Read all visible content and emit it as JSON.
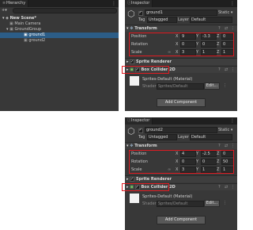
{
  "hierarchy": {
    "tab": "Hierarchy",
    "add_label": "+▾",
    "scene": "New Scene*",
    "items": [
      "Main Camera",
      "GroundGroup",
      "ground1",
      "ground2"
    ]
  },
  "inspector1": {
    "tab": "Inspector",
    "name": "ground1",
    "static_label": "Static ▾",
    "tag_label": "Tag",
    "tag_value": "Untagged",
    "layer_label": "Layer",
    "layer_value": "Default",
    "transform": {
      "title": "Transform",
      "position": {
        "label": "Position",
        "x": "9",
        "y": "-3.3",
        "z": "0"
      },
      "rotation": {
        "label": "Rotation",
        "x": "0",
        "y": "0",
        "z": "0"
      },
      "scale": {
        "label": "Scale",
        "x": "3",
        "y": "1",
        "z": "1"
      }
    },
    "sprite_renderer": "Sprite Renderer",
    "box_collider": "Box Collider 2D",
    "material": "Sprites-Default (Material)",
    "shader_label": "Shader",
    "shader_value": "Sprites/Default",
    "edit_label": "Edit...",
    "add_component": "Add Component"
  },
  "inspector2": {
    "tab": "Inspector",
    "name": "ground2",
    "static_label": "Static ▾",
    "tag_label": "Tag",
    "tag_value": "Untagged",
    "layer_label": "Layer",
    "layer_value": "Default",
    "transform": {
      "title": "Transform",
      "position": {
        "label": "Position",
        "x": "4",
        "y": "-2.5",
        "z": "0"
      },
      "rotation": {
        "label": "Rotation",
        "x": "0",
        "y": "0",
        "z": "50"
      },
      "scale": {
        "label": "Scale",
        "x": "3",
        "y": "1",
        "z": "1"
      }
    },
    "sprite_renderer": "Sprite Renderer",
    "box_collider": "Box Collider 2D",
    "material": "Sprites-Default (Material)",
    "shader_label": "Shader",
    "shader_value": "Sprites/Default",
    "edit_label": "Edit...",
    "add_component": "Add Component"
  },
  "colors": {
    "highlight": "#e11b22",
    "selection": "#2c5d87",
    "panel": "#383838"
  }
}
